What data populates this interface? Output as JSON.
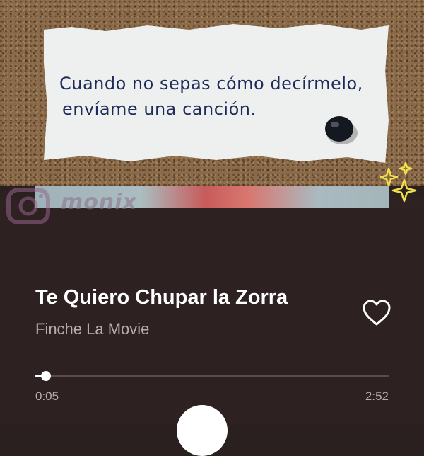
{
  "note": {
    "line1": "Cuando no sepas cómo decírmelo,",
    "line2": "envíame una canción."
  },
  "watermark": {
    "handle": "monix"
  },
  "track": {
    "title": "Te Quiero Chupar la Zorra",
    "artist": "Finche La Movie",
    "liked": false,
    "elapsed": "0:05",
    "duration": "2:52",
    "progress_fraction": 0.029
  },
  "controls": {
    "play_icon": "play-icon",
    "heart_icon": "heart-outline-icon"
  },
  "colors": {
    "panel_bg": "#2d2121",
    "title": "#ffffff",
    "secondary_text": "#b7adad",
    "track_bg": "#5a4a4a",
    "note_ink": "#1e2a5a"
  }
}
